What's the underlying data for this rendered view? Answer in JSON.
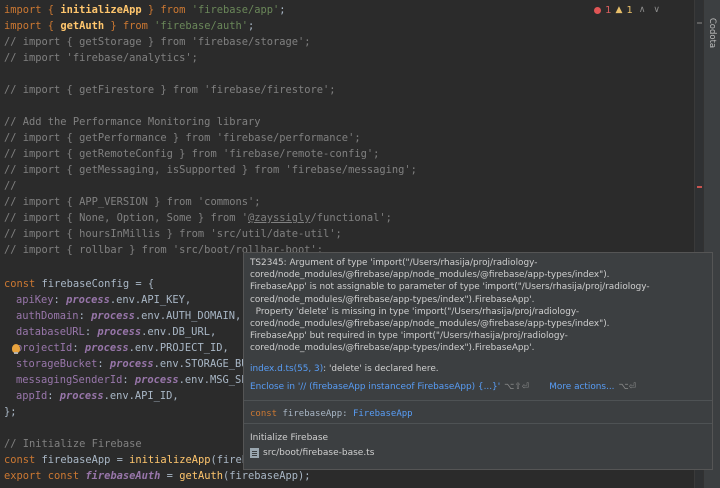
{
  "code_lines": [
    [
      "import { ",
      "initializeApp",
      " } from ",
      "'firebase/app'",
      ";"
    ],
    [
      "import { ",
      "getAuth",
      " } from ",
      "'firebase/auth'",
      ";"
    ],
    [
      "// import { getStorage } from 'firebase/storage';"
    ],
    [
      "// import 'firebase/analytics';"
    ],
    [
      ""
    ],
    [
      "// import { getFirestore } from 'firebase/firestore';"
    ],
    [
      ""
    ],
    [
      "// Add the Performance Monitoring library"
    ],
    [
      "// import { getPerformance } from 'firebase/performance';"
    ],
    [
      "// import { getRemoteConfig } from 'firebase/remote-config';"
    ],
    [
      "// import { getMessaging, isSupported } from 'firebase/messaging';"
    ],
    [
      "//"
    ],
    [
      "// import { APP_VERSION } from 'commons';"
    ],
    [
      "// import { None, Option, Some } from '",
      "@zayssigly",
      "/functional';"
    ],
    [
      "// import { hoursInMillis } from 'src/util/date-util';"
    ],
    [
      "// import { rollbar } from 'src/boot/rollbar-boot';"
    ],
    [
      ""
    ],
    [
      "const ",
      "firebaseConfig",
      " = {"
    ],
    [
      "apiKey",
      ": ",
      "process",
      ".env.API_KEY,"
    ],
    [
      "authDomain",
      ": ",
      "process",
      ".env.AUTH_DOMAIN,"
    ],
    [
      "databaseURL",
      ": ",
      "process",
      ".env.DB_URL,"
    ],
    [
      "projectId",
      ": ",
      "process",
      ".env.PROJECT_ID,"
    ],
    [
      "storageBucket",
      ": ",
      "process",
      ".env.STORAGE_BUCKET,"
    ],
    [
      "messagingSenderId",
      ": ",
      "process",
      ".env.MSG_SENDER_ID,"
    ],
    [
      "appId",
      ": ",
      "process",
      ".env.API_ID,"
    ],
    [
      "};"
    ],
    [
      ""
    ],
    [
      "// Initialize Firebase"
    ],
    [
      "const ",
      "firebaseApp",
      " = ",
      "initializeApp",
      "(firebaseConfig);"
    ],
    [
      "export const ",
      "firebaseAuth",
      " = ",
      "getAuth",
      "(firebaseApp);"
    ]
  ],
  "inspection": {
    "errors": "1",
    "warnings": "1",
    "up": "∧",
    "down": "∨"
  },
  "tool_window": {
    "label": "Codota"
  },
  "popup": {
    "message": "TS2345: Argument of type 'import(\"/Users/rhasija/proj/radiology-\ncored/node_modules/@firebase/app/node_modules/@firebase/app-types/index\").\nFirebaseApp' is not assignable to parameter of type 'import(\"/Users/rhasija/proj/radiology-\ncored/node_modules/@firebase/app-types/index\").FirebaseApp'.\n  Property 'delete' is missing in type 'import(\"/Users/rhasija/proj/radiology-\ncored/node_modules/@firebase/app/node_modules/@firebase/app-types/index\").\nFirebaseApp' but required in type 'import(\"/Users/rhasija/proj/radiology-\ncored/node_modules/@firebase/app-types/index\").FirebaseApp'.",
    "decl_link": "index.d.ts(55, 3)",
    "decl_text": ": 'delete' is declared here.",
    "action_1": "Enclose in '// (firebaseApp instanceof FirebaseApp) {...}'",
    "action_1_shortcut": "⌥⇧⏎",
    "action_2": "More actions...",
    "action_2_shortcut": "⌥⏎",
    "sig_kw": "const ",
    "sig_name": "firebaseApp",
    "sig_sep": ": ",
    "sig_type": "FirebaseApp",
    "doc": "Initialize Firebase",
    "file": "src/boot/firebase-base.ts"
  }
}
